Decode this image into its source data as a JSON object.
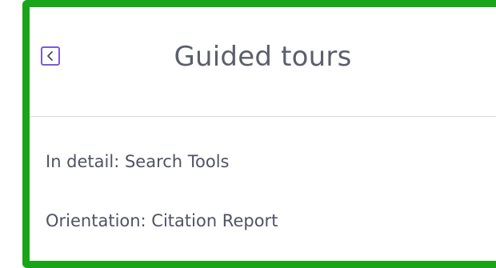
{
  "header": {
    "title": "Guided tours",
    "back_icon": "chevron-left-icon",
    "accent_color": "#7d5bd6"
  },
  "frame": {
    "highlight_color": "#1aa41a"
  },
  "tours": [
    {
      "label": "In detail: Search Tools"
    },
    {
      "label": "Orientation: Citation Report"
    }
  ]
}
